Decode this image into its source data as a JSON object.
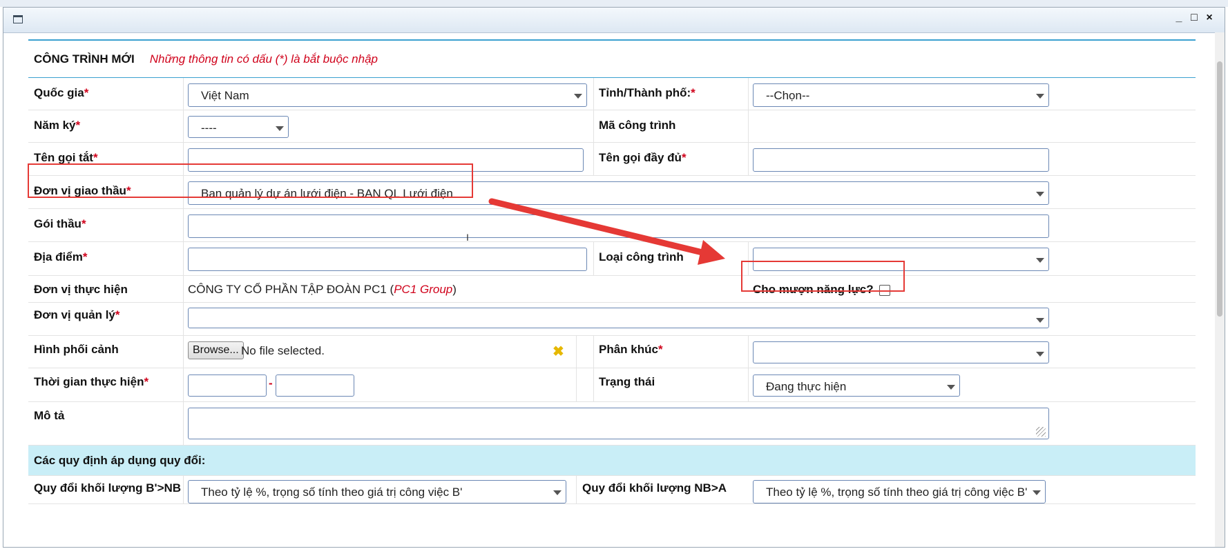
{
  "window": {
    "controls": {
      "minimize": "_",
      "maximize": "□",
      "close": "×"
    }
  },
  "form": {
    "title": "CÔNG TRÌNH MỚI",
    "required_note": "Những thông tin có dấu (*) là bắt buộc nhập",
    "required_mark": "*",
    "country": {
      "label": "Quốc gia",
      "value": "Việt Nam"
    },
    "province": {
      "label": "Tỉnh/Thành phố:",
      "value": "--Chọn--"
    },
    "sign_year": {
      "label": "Năm ký",
      "value": "----"
    },
    "project_code": {
      "label": "Mã công trình",
      "value": ""
    },
    "short_name": {
      "label": "Tên gọi tắt",
      "value": ""
    },
    "full_name": {
      "label": "Tên gọi đầy đủ",
      "value": ""
    },
    "tender_unit": {
      "label": "Đơn vị giao thầu",
      "value": "Ban quản lý dự án lưới điện - BAN QL Lưới điện"
    },
    "package": {
      "label": "Gói thầu",
      "value": ""
    },
    "location": {
      "label": "Địa điểm",
      "value": ""
    },
    "project_type": {
      "label": "Loại công trình",
      "value": ""
    },
    "executor": {
      "label": "Đơn vị thực hiện",
      "company": "CÔNG TY CỔ PHẦN TẬP ĐOÀN PC1",
      "open_paren": " (",
      "group": "PC1 Group",
      "close_paren": ")"
    },
    "lend_capacity": {
      "label": "Cho mượn năng lực?",
      "checked": false
    },
    "manager_unit": {
      "label": "Đơn vị quản lý",
      "value": ""
    },
    "perspective": {
      "label": "Hình phối cảnh",
      "browse": "Browse...",
      "file_status": "No file selected."
    },
    "segment": {
      "label": "Phân khúc",
      "value": ""
    },
    "duration": {
      "label": "Thời gian thực hiện",
      "separator": "-",
      "from": "",
      "to": ""
    },
    "status": {
      "label": "Trạng thái",
      "value": "Đang thực hiện"
    },
    "description": {
      "label": "Mô tả",
      "value": ""
    },
    "rules_section": "Các quy định áp dụng quy đổi:",
    "convert_b_nb": {
      "label": "Quy đổi khối lượng B'>NB",
      "value": "Theo tỷ lệ %, trọng số tính theo giá trị công việc B'"
    },
    "convert_nb_a": {
      "label": "Quy đổi khối lượng NB>A",
      "value": "Theo tỷ lệ %, trọng số tính theo giá trị công việc B'"
    }
  },
  "colors": {
    "accent": "#3aa0d0",
    "required": "#d0021b",
    "annotation": "#e53935",
    "section_bg": "#c9eef7"
  },
  "icons": [
    "window-icon",
    "minimize-icon",
    "maximize-icon",
    "close-icon",
    "dropdown-caret-icon",
    "clear-icon",
    "annotation-arrow-icon",
    "text-cursor-icon",
    "resize-handle-icon"
  ]
}
